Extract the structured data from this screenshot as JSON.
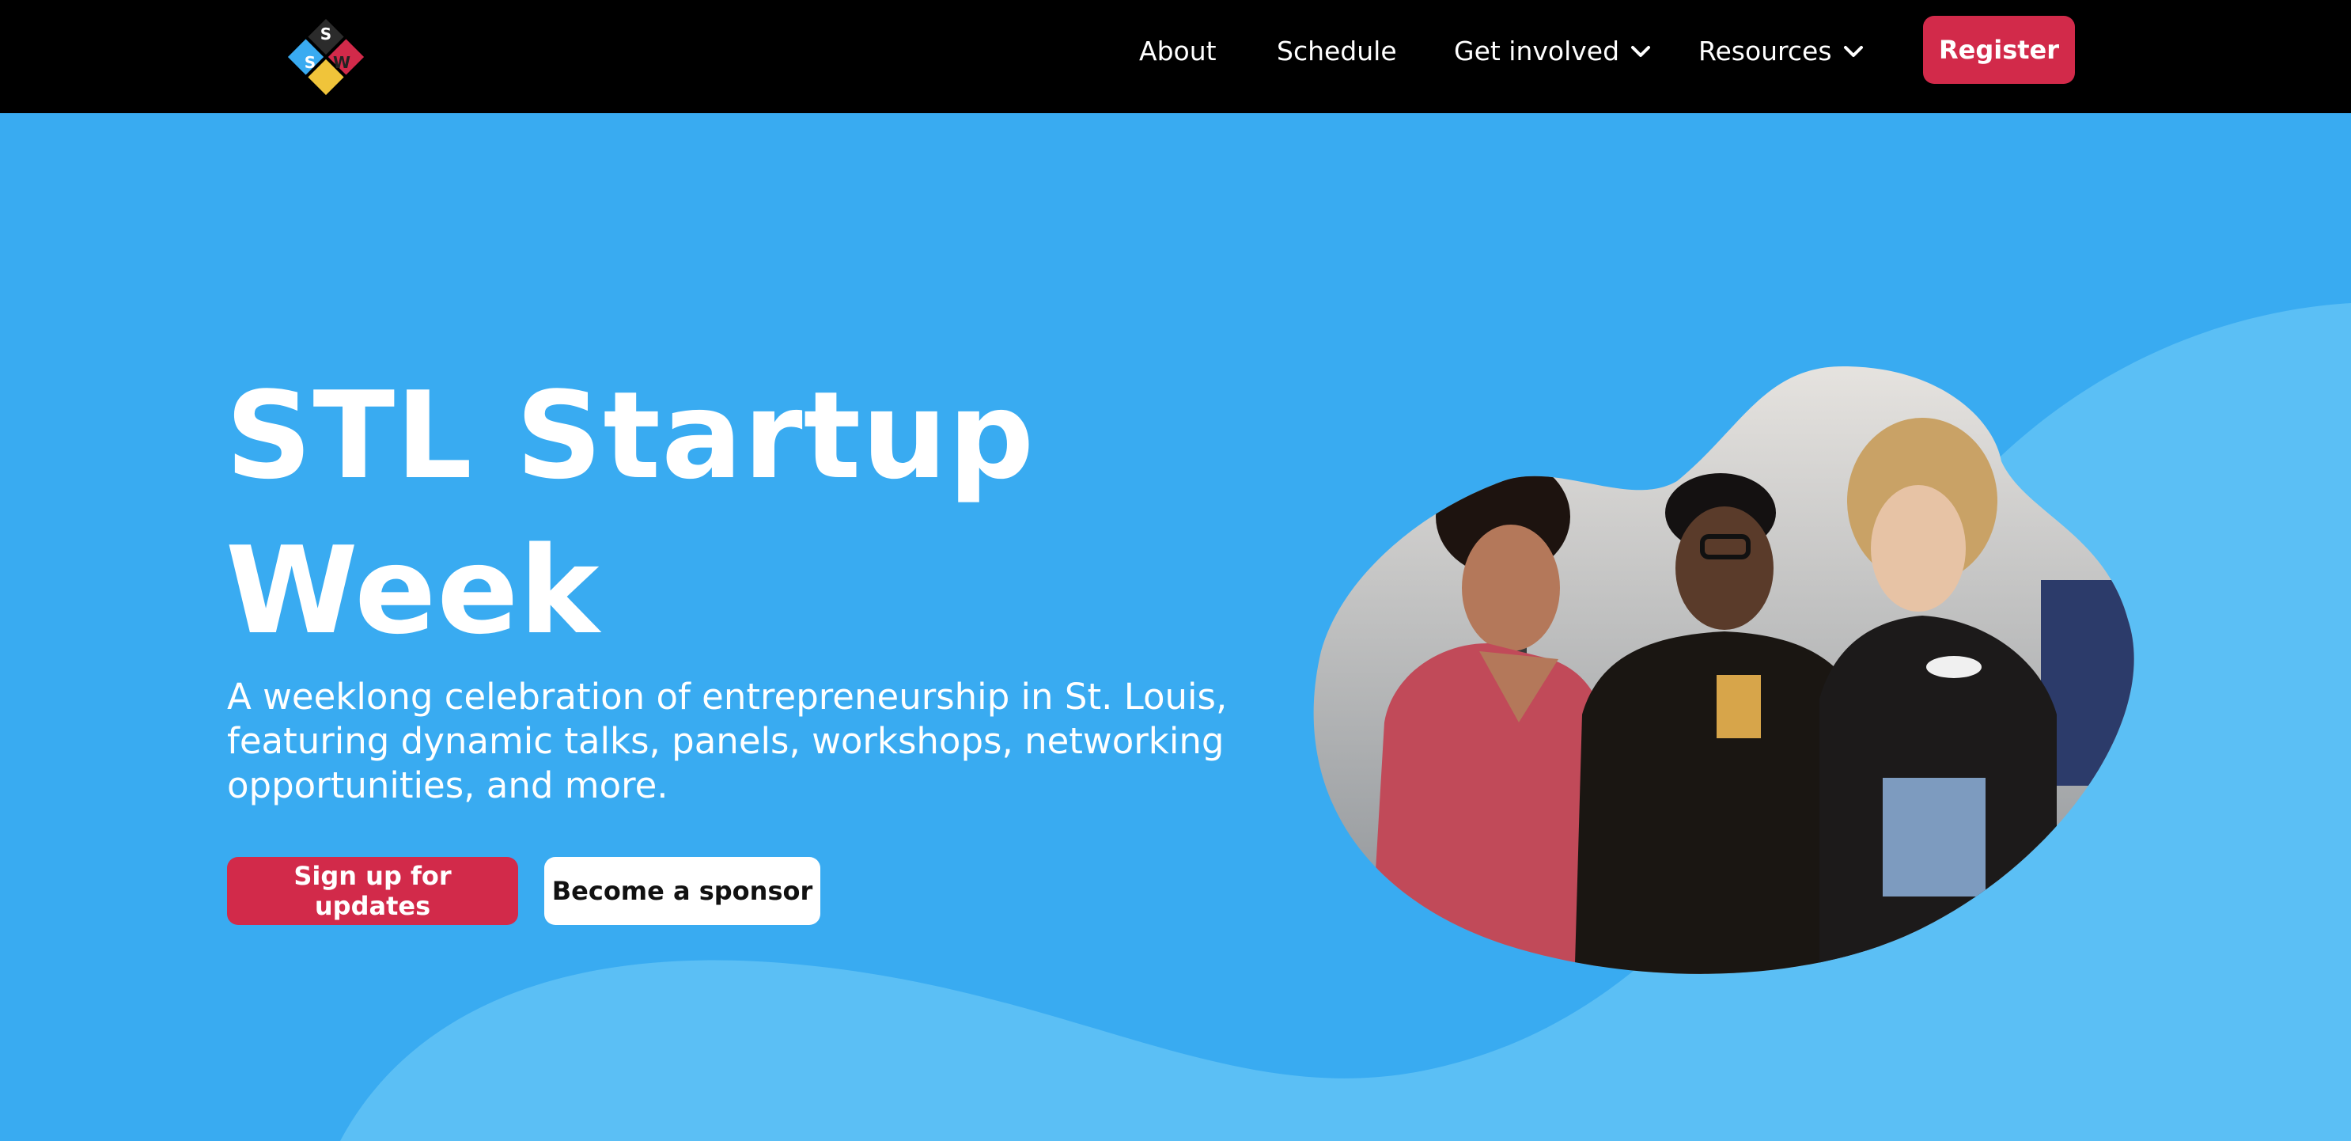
{
  "colors": {
    "nav_bg": "#000000",
    "hero_bg": "#39abf1",
    "hero_wave": "#5bbff5",
    "accent_red": "#d22a4a",
    "white": "#ffffff"
  },
  "logo": {
    "icon": "sw-diamond-logo-icon",
    "letters": [
      "S",
      "S",
      "W"
    ]
  },
  "nav": {
    "items": [
      {
        "label": "About",
        "has_dropdown": false
      },
      {
        "label": "Schedule",
        "has_dropdown": false
      },
      {
        "label": "Get involved",
        "has_dropdown": true,
        "icon": "chevron-down-icon"
      },
      {
        "label": "Resources",
        "has_dropdown": true,
        "icon": "chevron-down-icon"
      }
    ],
    "register_label": "Register"
  },
  "hero": {
    "title_line1": "STL Startup",
    "title_line2": "Week",
    "subtitle_line1": "A weeklong celebration of entrepreneurship in St. Louis,",
    "subtitle_line2": "featuring dynamic talks, panels, workshops, networking",
    "subtitle_line3": "opportunities, and more.",
    "primary_button": "Sign up for updates",
    "secondary_button": "Become a sponsor",
    "photo_alt": "three-women-smiling-photo"
  }
}
